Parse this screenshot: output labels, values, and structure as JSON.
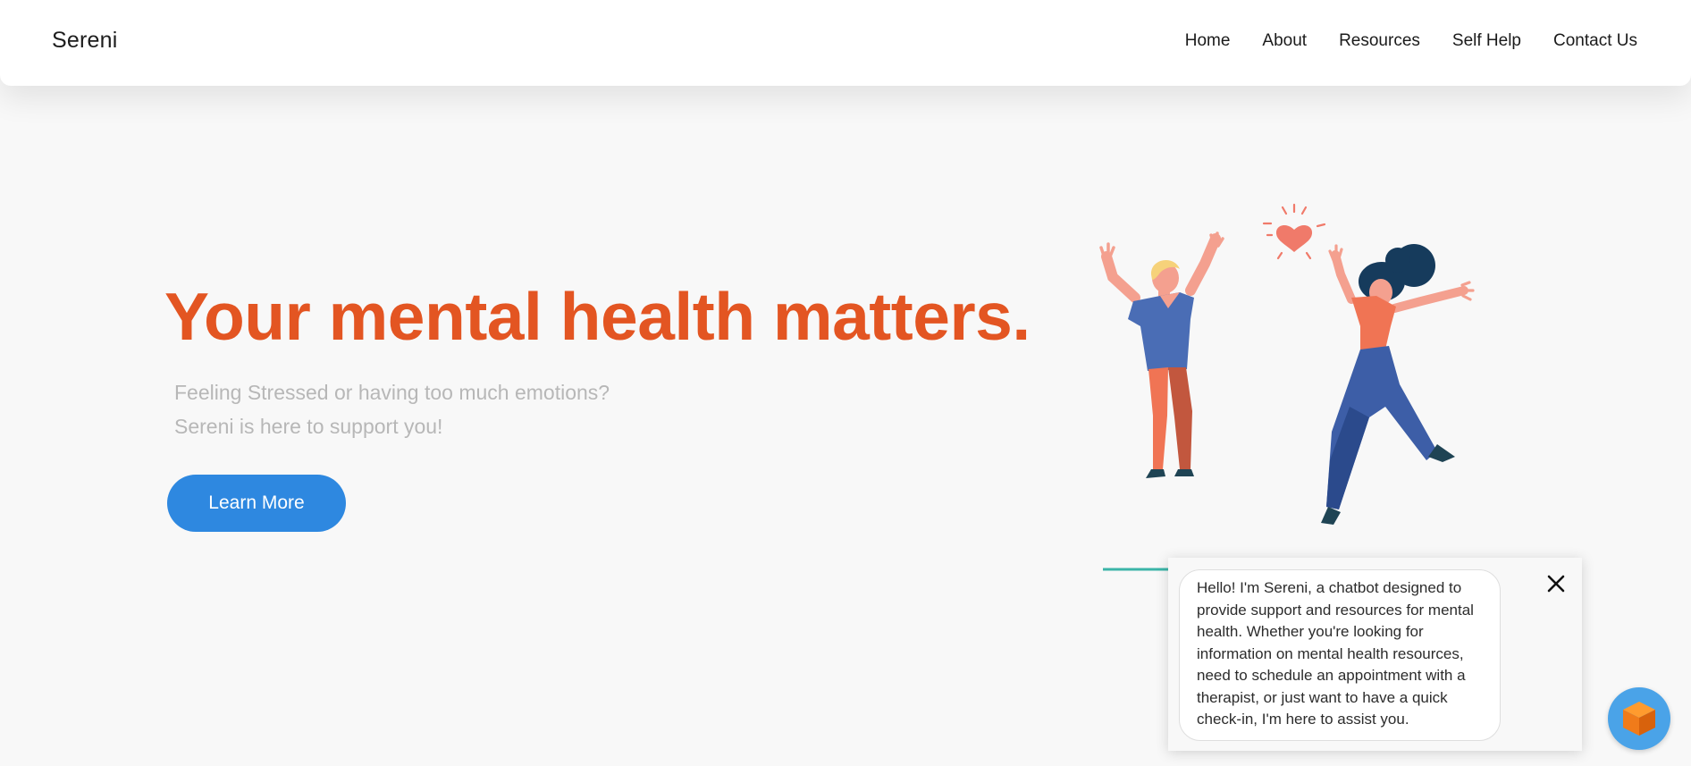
{
  "header": {
    "brand": "Sereni",
    "nav": [
      "Home",
      "About",
      "Resources",
      "Self Help",
      "Contact Us"
    ]
  },
  "hero": {
    "title": "Your mental health matters.",
    "subtitle_line1": "Feeling Stressed or having too much emotions?",
    "subtitle_line2": "Sereni is here to support you!",
    "cta_label": "Learn More"
  },
  "illustration": {
    "icon": "people-jumping-illustration",
    "heart_icon": "heart-icon"
  },
  "chat": {
    "message": "Hello! I'm Sereni, a chatbot designed to provide support and resources for mental health. Whether you're looking for information on mental health resources, need to schedule an appointment with a therapist, or just want to have a quick check-in, I'm here to assist you.",
    "close_icon": "close-icon",
    "launcher_icon": "cube-icon"
  },
  "colors": {
    "accent": "#e35522",
    "button": "#2e88e0",
    "background": "#f8f8f8",
    "subtitle": "#b7b7b7",
    "launcher": "#4aa3e8"
  }
}
